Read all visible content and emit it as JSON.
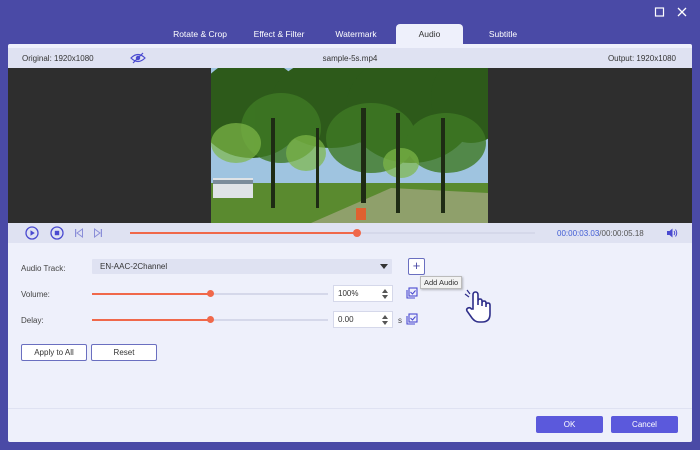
{
  "tabs": [
    {
      "label": "Rotate & Crop"
    },
    {
      "label": "Effect & Filter"
    },
    {
      "label": "Watermark"
    },
    {
      "label": "Audio",
      "active": true
    },
    {
      "label": "Subtitle"
    }
  ],
  "infobar": {
    "original": "Original: 1920x1080",
    "filename": "sample-5s.mp4",
    "output": "Output: 1920x1080"
  },
  "playback": {
    "current_time": "00:00:03.03",
    "total_time": "/00:00:05.18",
    "progress": 0.56
  },
  "audio": {
    "track_label": "Audio Track:",
    "track_value": "EN-AAC-2Channel",
    "add_audio_tooltip": "Add Audio",
    "volume_label": "Volume:",
    "volume_value": "100%",
    "volume_level": 0.5,
    "delay_label": "Delay:",
    "delay_value": "0.00",
    "delay_unit": "s",
    "delay_level": 0.5
  },
  "buttons": {
    "apply_all": "Apply to All",
    "reset": "Reset",
    "ok": "OK",
    "cancel": "Cancel"
  },
  "colors": {
    "accent": "#5b59dc",
    "title_bar": "#4a4aa6",
    "slider": "#f0684a",
    "time_current": "#3f5bd4"
  }
}
